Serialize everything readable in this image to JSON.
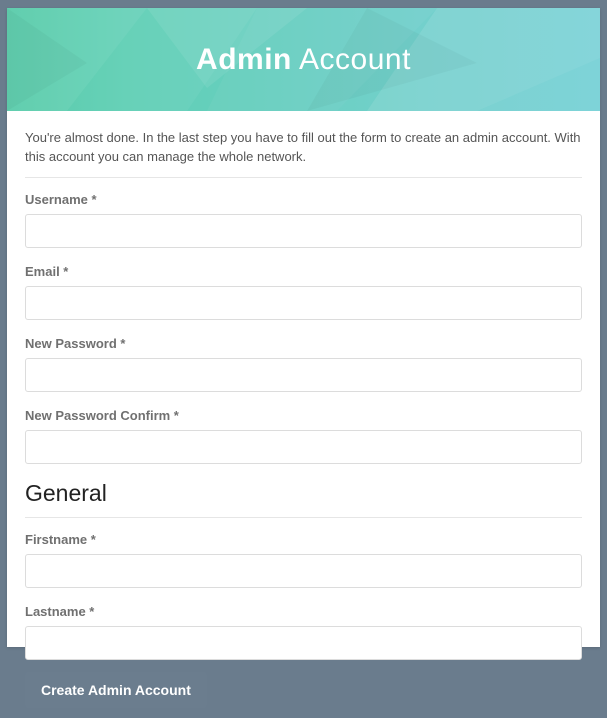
{
  "hero": {
    "title_bold": "Admin",
    "title_light": "Account"
  },
  "intro_text": "You're almost done. In the last step you have to fill out the form to create an admin account. With this account you can manage the whole network.",
  "fields": {
    "username": {
      "label": "Username *",
      "value": ""
    },
    "email": {
      "label": "Email *",
      "value": ""
    },
    "password": {
      "label": "New Password *",
      "value": ""
    },
    "password2": {
      "label": "New Password Confirm *",
      "value": ""
    },
    "firstname": {
      "label": "Firstname *",
      "value": ""
    },
    "lastname": {
      "label": "Lastname *",
      "value": ""
    }
  },
  "section_general": "General",
  "submit_label": "Create Admin Account"
}
